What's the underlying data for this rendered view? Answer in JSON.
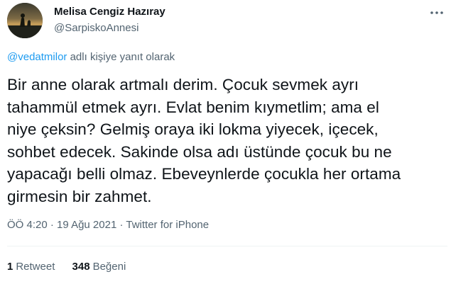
{
  "author": {
    "display_name": "Melisa Cengiz Hazıray",
    "handle": "@SarpiskoAnnesi",
    "avatar_icon": "profile-photo"
  },
  "reply": {
    "mention": "@vedatmilor",
    "suffix": " adlı kişiye yanıt olarak"
  },
  "tweet": {
    "text": "Bir anne olarak artmalı derim. Çocuk sevmek ayrı\ntahammül etmek ayrı. Evlat benim kıymetlim; ama el\nniye çeksin? Gelmiş oraya iki lokma yiyecek, içecek,\nsohbet edecek. Sakinde olsa adı üstünde çocuk bu ne\nyapacağı belli olmaz. Ebeveynlerde çocukla her ortama\ngirmesin bir zahmet."
  },
  "meta": {
    "time": "ÖÖ 4:20",
    "separator": " · ",
    "date": "19 Ağu 2021",
    "separator2": " · ",
    "source": "Twitter for iPhone"
  },
  "stats": {
    "retweets_count": "1",
    "retweets_label": "Retweet",
    "likes_count": "348",
    "likes_label": "Beğeni"
  },
  "colors": {
    "text": "#0f1419",
    "secondary": "#536471",
    "link": "#1d9bf0",
    "divider": "#eff3f4"
  }
}
